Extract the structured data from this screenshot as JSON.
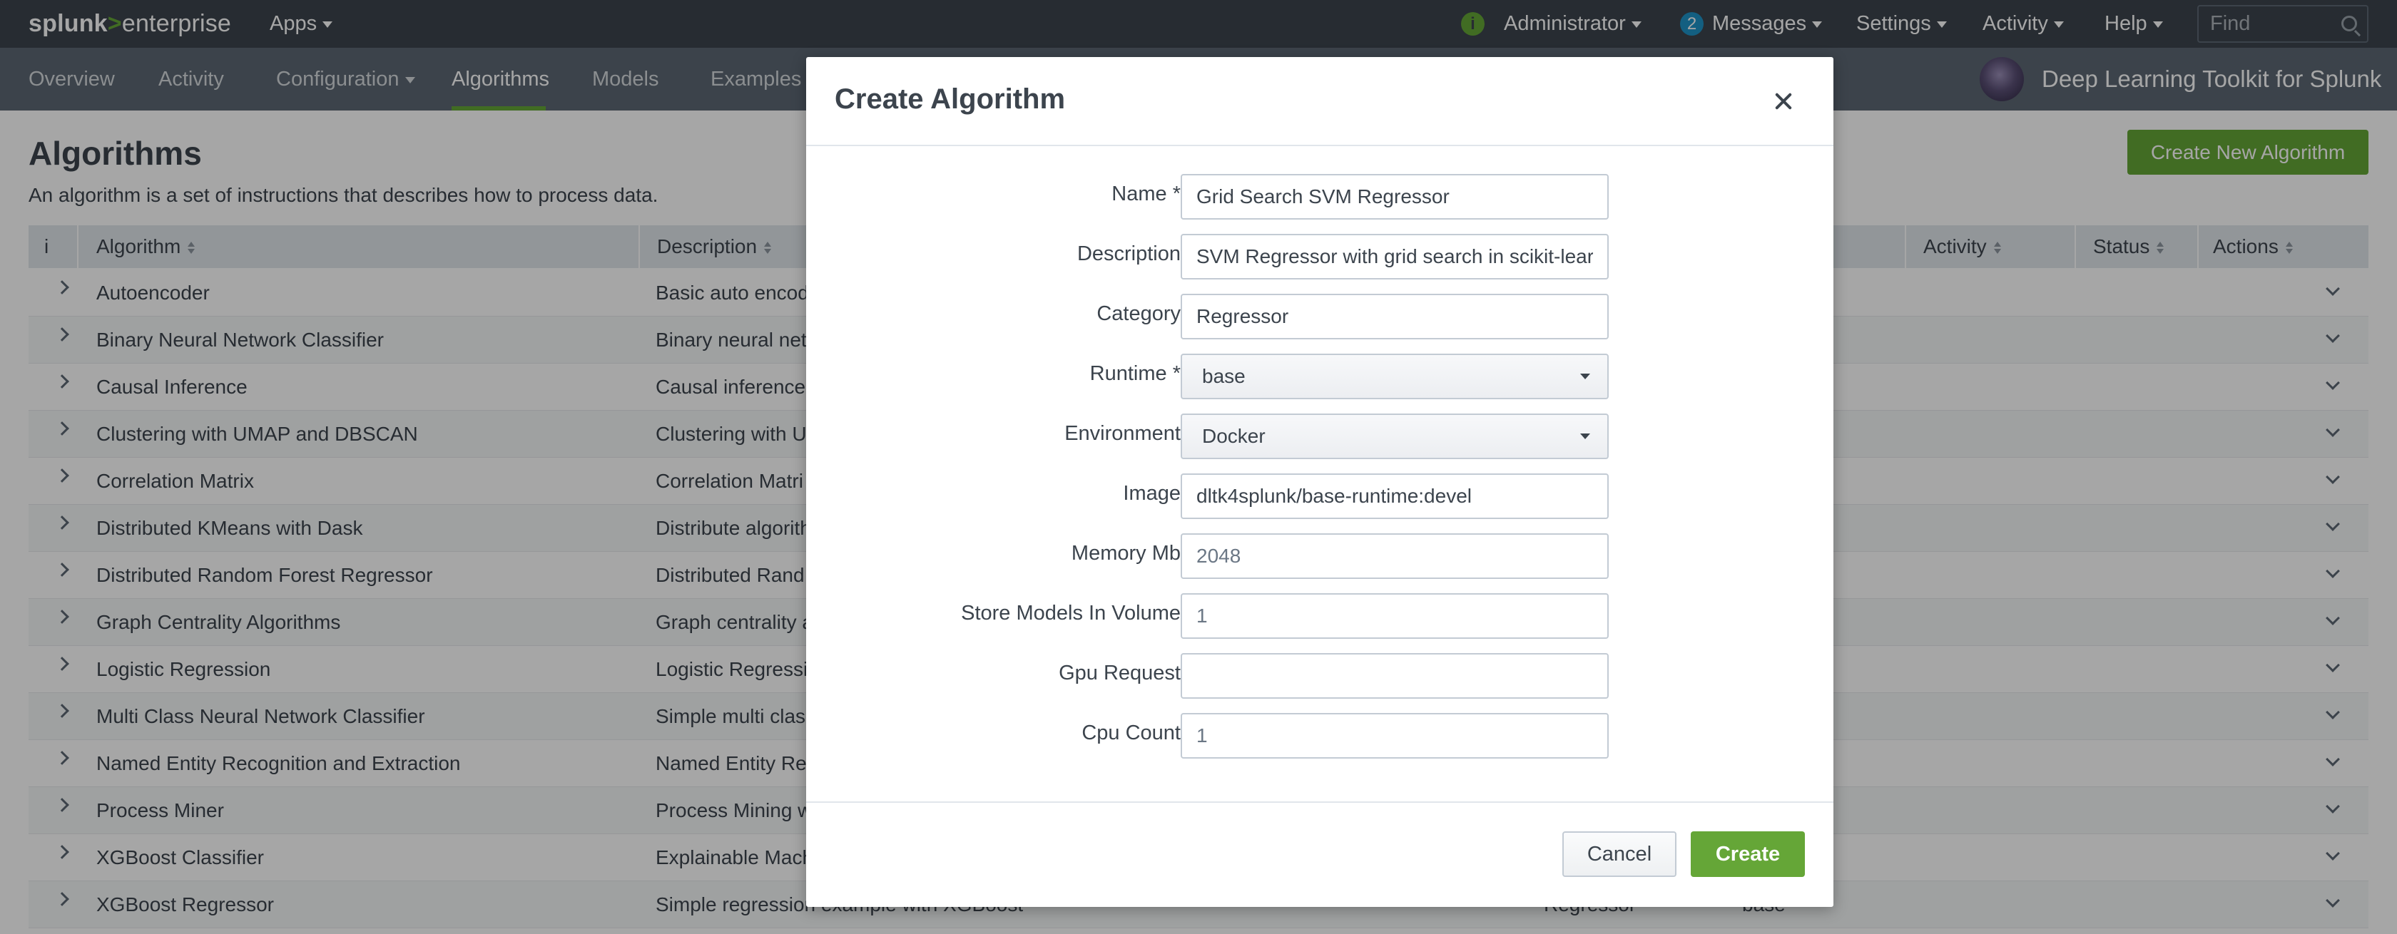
{
  "topbar": {
    "logo": {
      "brand": "splunk",
      "gt": ">",
      "product": "enterprise"
    },
    "apps_label": "Apps",
    "user_label": "Administrator",
    "messages_count": "2",
    "messages_label": "Messages",
    "settings_label": "Settings",
    "activity_label": "Activity",
    "help_label": "Help",
    "find_placeholder": "Find",
    "info_glyph": "i"
  },
  "appnav": {
    "items": [
      {
        "label": "Overview"
      },
      {
        "label": "Activity"
      },
      {
        "label": "Configuration"
      },
      {
        "label": "Algorithms"
      },
      {
        "label": "Models"
      },
      {
        "label": "Examples"
      }
    ],
    "active": "Algorithms",
    "app_title": "Deep Learning Toolkit for Splunk"
  },
  "page": {
    "title": "Algorithms",
    "description": "An algorithm is a set of instructions that describes how to process data.",
    "create_new_label": "Create New Algorithm"
  },
  "table": {
    "info_glyph": "i",
    "columns": {
      "algorithm": "Algorithm",
      "description": "Description",
      "activity": "Activity",
      "status": "Status",
      "actions": "Actions"
    },
    "rows": [
      {
        "name": "Autoencoder",
        "description": "Basic auto encod"
      },
      {
        "name": "Binary Neural Network Classifier",
        "description": "Binary neural net"
      },
      {
        "name": "Causal Inference",
        "description": "Causal inference"
      },
      {
        "name": "Clustering with UMAP and DBSCAN",
        "description": "Clustering with U"
      },
      {
        "name": "Correlation Matrix",
        "description": "Correlation Matri"
      },
      {
        "name": "Distributed KMeans with Dask",
        "description": "Distribute algorith"
      },
      {
        "name": "Distributed Random Forest Regressor",
        "description": "Distributed Rand"
      },
      {
        "name": "Graph Centrality Algorithms",
        "description": "Graph centrality a"
      },
      {
        "name": "Logistic Regression",
        "description": "Logistic Regressi"
      },
      {
        "name": "Multi Class Neural Network Classifier",
        "description": "Simple multi class"
      },
      {
        "name": "Named Entity Recognition and Extraction",
        "description": "Named Entity Rec"
      },
      {
        "name": "Process Miner",
        "description": "Process Mining w"
      },
      {
        "name": "XGBoost Classifier",
        "description": "Explainable Mach"
      },
      {
        "name": "XGBoost Regressor",
        "description": "Simple regression example with XGBoost",
        "category": "Regressor",
        "runtime": "base"
      }
    ]
  },
  "modal": {
    "title": "Create Algorithm",
    "fields": {
      "name": {
        "label": "Name *",
        "value": "Grid Search SVM Regressor"
      },
      "description": {
        "label": "Description",
        "value": "SVM Regressor with grid search in scikit-learn"
      },
      "category": {
        "label": "Category",
        "value": "Regressor"
      },
      "runtime": {
        "label": "Runtime *",
        "value": "base"
      },
      "environment": {
        "label": "Environment",
        "value": "Docker"
      },
      "image": {
        "label": "Image",
        "value": "dltk4splunk/base-runtime:devel"
      },
      "memory_mb": {
        "label": "Memory Mb",
        "placeholder": "2048"
      },
      "store_models": {
        "label": "Store Models In Volume",
        "placeholder": "1"
      },
      "gpu_request": {
        "label": "Gpu Request",
        "value": ""
      },
      "cpu_count": {
        "label": "Cpu Count",
        "placeholder": "1"
      }
    },
    "cancel_label": "Cancel",
    "create_label": "Create"
  },
  "colors": {
    "topbar_bg": "#3c444d",
    "appbar_bg": "#5c6773",
    "accent_green": "#65a637",
    "badge_blue": "#1e93c6"
  }
}
